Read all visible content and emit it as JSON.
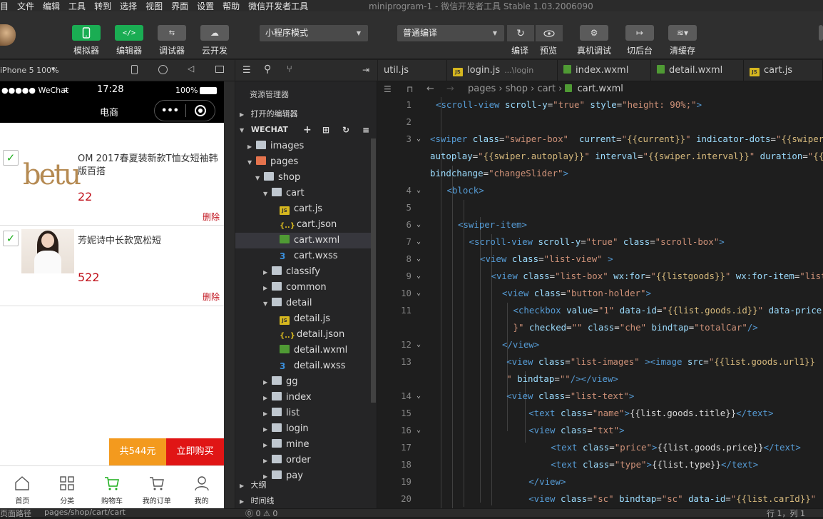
{
  "menu": {
    "items": [
      "项目",
      "文件",
      "编辑",
      "工具",
      "转到",
      "选择",
      "视图",
      "界面",
      "设置",
      "帮助",
      "微信开发者工具"
    ],
    "window_title": "miniprogram-1 - 微信开发者工具 Stable 1.03.2006090"
  },
  "toolbar": {
    "simulator": "模拟器",
    "editor": "编辑器",
    "debugger": "调试器",
    "cloud": "云开发",
    "mode_select": "小程序模式",
    "compile_select": "普通编译",
    "compile": "编译",
    "preview": "预览",
    "real_debug": "真机调试",
    "background": "切后台",
    "clear_cache": "清缓存"
  },
  "simulator": {
    "device": "iPhone 5 100%",
    "carrier": "●●●●● WeChat",
    "time": "17:28",
    "battery": "100%",
    "nav_title": "电商",
    "capsule_more": "•••",
    "items": [
      {
        "title": "OM 2017春夏装新款T恤女短袖韩版百搭",
        "price": "22",
        "delete": "删除",
        "brand": "betu"
      },
      {
        "title": "芳妮诗中长款宽松短",
        "price": "522",
        "delete": "删除"
      }
    ],
    "total": "共544元",
    "buy_now": "立即购买",
    "tabbar": [
      "首页",
      "分类",
      "购物车",
      "我的订单",
      "我的"
    ]
  },
  "explorer": {
    "title": "资源管理器",
    "open_editors": "打开的编辑器",
    "workspace": "WECHAT",
    "tree": [
      {
        "label": "images",
        "type": "folder",
        "depth": 1,
        "open": false
      },
      {
        "label": "pages",
        "type": "folder-special",
        "depth": 1,
        "open": true
      },
      {
        "label": "shop",
        "type": "folder",
        "depth": 2,
        "open": true
      },
      {
        "label": "cart",
        "type": "folder",
        "depth": 3,
        "open": true
      },
      {
        "label": "cart.js",
        "type": "js",
        "depth": 4
      },
      {
        "label": "cart.json",
        "type": "json",
        "depth": 4
      },
      {
        "label": "cart.wxml",
        "type": "wxml",
        "depth": 4,
        "selected": true
      },
      {
        "label": "cart.wxss",
        "type": "wxss",
        "depth": 4
      },
      {
        "label": "classify",
        "type": "folder",
        "depth": 3,
        "open": false
      },
      {
        "label": "common",
        "type": "folder",
        "depth": 3,
        "open": false,
        "hover": true
      },
      {
        "label": "detail",
        "type": "folder",
        "depth": 3,
        "open": true
      },
      {
        "label": "detail.js",
        "type": "js",
        "depth": 4
      },
      {
        "label": "detail.json",
        "type": "json",
        "depth": 4
      },
      {
        "label": "detail.wxml",
        "type": "wxml",
        "depth": 4
      },
      {
        "label": "detail.wxss",
        "type": "wxss",
        "depth": 4
      },
      {
        "label": "gg",
        "type": "folder",
        "depth": 3,
        "open": false
      },
      {
        "label": "index",
        "type": "folder",
        "depth": 3,
        "open": false
      },
      {
        "label": "list",
        "type": "folder",
        "depth": 3,
        "open": false
      },
      {
        "label": "login",
        "type": "folder",
        "depth": 3,
        "open": false
      },
      {
        "label": "mine",
        "type": "folder",
        "depth": 3,
        "open": false
      },
      {
        "label": "order",
        "type": "folder",
        "depth": 3,
        "open": false
      },
      {
        "label": "pay",
        "type": "folder",
        "depth": 3,
        "open": false
      }
    ],
    "outline": "大纲",
    "timeline": "时间线"
  },
  "editor": {
    "tabs": [
      {
        "label": "util.js",
        "sub": ""
      },
      {
        "label": "login.js",
        "sub": "...\\login"
      },
      {
        "label": "index.wxml",
        "sub": ""
      },
      {
        "label": "detail.wxml",
        "sub": ""
      },
      {
        "label": "cart.js",
        "sub": ""
      }
    ],
    "breadcrumb": [
      "pages",
      "shop",
      "cart",
      "cart.wxml"
    ],
    "lines": [
      {
        "n": "1",
        "fold": false,
        "indent": 0,
        "html": "<span class='tg'>&lt;scroll-view</span> <span class='at'>scroll-y</span>=<span class='st'>\"true\"</span> <span class='at'>style</span>=<span class='st'>\"height: 90%;\"</span><span class='tg'>&gt;</span>"
      },
      {
        "n": "2",
        "fold": false,
        "indent": 0,
        "html": ""
      },
      {
        "n": "3",
        "fold": true,
        "indent": -1,
        "html": "<span class='tg'>&lt;swiper</span> <span class='at'>class</span>=<span class='st'>\"swiper-box\"</span>  <span class='at'>current</span>=<span class='st'>\"<span class='wx'>{{current}}</span>\"</span> <span class='at'>indicator-dots</span>=<span class='st'>\"<span class='wx'>{{swiper.indicatorDots}}</span>\"</span>"
      },
      {
        "n": "",
        "fold": false,
        "indent": -1,
        "html": "<span class='at'>autoplay</span>=<span class='st'>\"<span class='wx'>{{swiper.autoplay}}</span>\"</span> <span class='at'>interval</span>=<span class='st'>\"<span class='wx'>{{swiper.interval}}</span>\"</span> <span class='at'>duration</span>=<span class='st'>\"<span class='wx'>{{swiper.duration}}</span>\"</span>"
      },
      {
        "n": "",
        "fold": false,
        "indent": -1,
        "html": "<span class='at'>bindchange</span>=<span class='st'>\"changeSlider\"</span><span class='tg'>&gt;</span>"
      },
      {
        "n": "4",
        "fold": true,
        "indent": 1,
        "html": "<span class='tg'>&lt;block&gt;</span>"
      },
      {
        "n": "5",
        "fold": false,
        "indent": 1,
        "html": ""
      },
      {
        "n": "6",
        "fold": true,
        "indent": 2,
        "html": "<span class='tg'>&lt;swiper-item&gt;</span>"
      },
      {
        "n": "7",
        "fold": true,
        "indent": 3,
        "html": "<span class='tg'>&lt;scroll-view</span> <span class='at'>scroll-y</span>=<span class='st'>\"true\"</span> <span class='at'>class</span>=<span class='st'>\"scroll-box\"</span><span class='tg'>&gt;</span>"
      },
      {
        "n": "8",
        "fold": true,
        "indent": 4,
        "html": "<span class='tg'>&lt;view</span> <span class='at'>class</span>=<span class='st'>\"list-view\"</span> <span class='tg'>&gt;</span>"
      },
      {
        "n": "9",
        "fold": true,
        "indent": 5,
        "html": "<span class='tg'>&lt;view</span> <span class='at'>class</span>=<span class='st'>\"list-box\"</span> <span class='at'>wx:for</span>=<span class='st'>\"<span class='wx'>{{listgoods}}</span>\"</span> <span class='at'>wx:for-item</span>=<span class='st'>\"list\"</span>"
      },
      {
        "n": "10",
        "fold": true,
        "indent": 6,
        "html": "<span class='tg'>&lt;view</span> <span class='at'>class</span>=<span class='st'>\"button-holder\"</span><span class='tg'>&gt;</span>"
      },
      {
        "n": "11",
        "fold": false,
        "indent": 7,
        "html": "<span class='tg'>&lt;checkbox</span> <span class='at'>value</span>=<span class='st'>\"1\"</span> <span class='at'>data-id</span>=<span class='st'>\"<span class='wx'>{{list.goods.id}}</span>\"</span> <span class='at'>data-price</span>"
      },
      {
        "n": "",
        "fold": false,
        "indent": 7,
        "html": "<span class='st'>}\"</span> <span class='at'>checked</span>=<span class='st'>\"\"</span> <span class='at'>class</span>=<span class='st'>\"che\"</span> <span class='at'>bindtap</span>=<span class='st'>\"totalCar\"</span><span class='tg'>/&gt;</span>"
      },
      {
        "n": "12",
        "fold": true,
        "indent": 6,
        "html": "<span class='tg'>&lt;/view&gt;</span>"
      },
      {
        "n": "13",
        "fold": false,
        "indent": 6.4,
        "html": "<span class='tg'>&lt;view</span> <span class='at'>class</span>=<span class='st'>\"list-images\"</span> <span class='tg'>&gt;&lt;image</span> <span class='at'>src</span>=<span class='st'>\"<span class='wx'>{{list.goods.url1}}</span></span>"
      },
      {
        "n": "",
        "fold": false,
        "indent": 6.4,
        "html": "<span class='st'>\"</span> <span class='at'>bindtap</span>=<span class='st'>\"\"</span><span class='tg'>/&gt;&lt;/view&gt;</span>"
      },
      {
        "n": "14",
        "fold": true,
        "indent": 6.4,
        "html": "<span class='tg'>&lt;view</span> <span class='at'>class</span>=<span class='st'>\"list-text\"</span><span class='tg'>&gt;</span>"
      },
      {
        "n": "15",
        "fold": false,
        "indent": 8.4,
        "html": "<span class='tg'>&lt;text</span> <span class='at'>class</span>=<span class='st'>\"name\"</span><span class='tg'>&gt;</span>{{list.goods.title}}<span class='tg'>&lt;/text&gt;</span>"
      },
      {
        "n": "16",
        "fold": true,
        "indent": 8.4,
        "html": "<span class='tg'>&lt;view</span> <span class='at'>class</span>=<span class='st'>\"txt\"</span><span class='tg'>&gt;</span>"
      },
      {
        "n": "17",
        "fold": false,
        "indent": 10.4,
        "html": "<span class='tg'>&lt;text</span> <span class='at'>class</span>=<span class='st'>\"price\"</span><span class='tg'>&gt;</span>{{list.goods.price}}<span class='tg'>&lt;/text&gt;</span>"
      },
      {
        "n": "18",
        "fold": false,
        "indent": 10.4,
        "html": "<span class='tg'>&lt;text</span> <span class='at'>class</span>=<span class='st'>\"type\"</span><span class='tg'>&gt;</span>{{list.type}}<span class='tg'>&lt;/text&gt;</span>"
      },
      {
        "n": "19",
        "fold": false,
        "indent": 8.4,
        "html": "<span class='tg'>&lt;/view&gt;</span>"
      },
      {
        "n": "20",
        "fold": false,
        "indent": 8.4,
        "html": "<span class='tg'>&lt;view</span> <span class='at'>class</span>=<span class='st'>\"sc\"</span> <span class='at'>bindtap</span>=<span class='st'>\"sc\"</span> <span class='at'>data-id</span>=<span class='st'>\"<span class='wx'>{{list.carId}}</span>\"</span>"
      }
    ]
  },
  "statusbar": {
    "page_path_label": "页面路径",
    "page_path": "pages/shop/cart/cart",
    "errors": "⓪ 0 ⚠ 0",
    "cursor": "行 1，列 1"
  }
}
